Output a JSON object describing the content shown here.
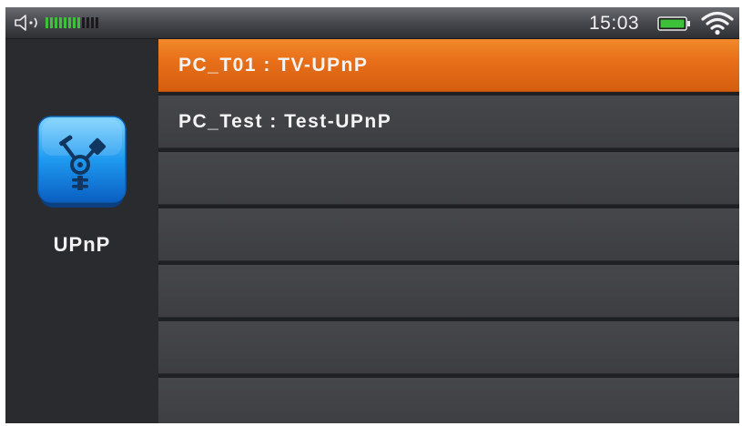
{
  "status_bar": {
    "time": "15:03",
    "volume_icon": "speaker-icon",
    "signal_icon": "signal-bars",
    "battery_icon": "battery-icon",
    "wifi_icon": "wifi-icon"
  },
  "sidebar": {
    "app_icon": "upnp-icon",
    "app_label": "UPnP"
  },
  "device_list": {
    "items": [
      {
        "label": "PC_T01 : TV-UPnP",
        "selected": true
      },
      {
        "label": "PC_Test : Test-UPnP",
        "selected": false
      },
      {
        "label": "",
        "selected": false
      },
      {
        "label": "",
        "selected": false
      },
      {
        "label": "",
        "selected": false
      },
      {
        "label": "",
        "selected": false
      },
      {
        "label": "",
        "selected": false
      }
    ]
  },
  "colors": {
    "selected_row": "#e8701a",
    "row": "#3d3e42",
    "signal_green": "#3ec13a",
    "battery_green": "#3ec13a"
  }
}
